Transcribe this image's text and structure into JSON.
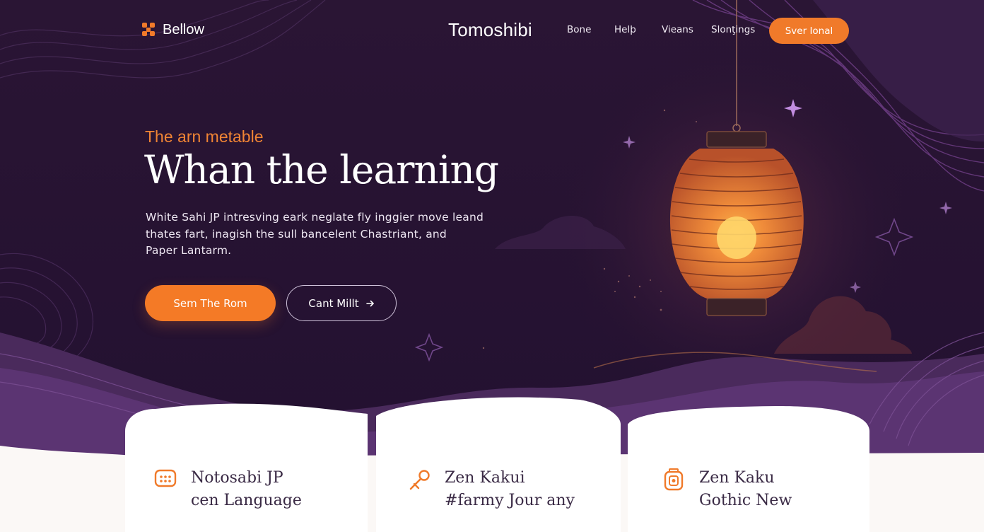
{
  "nav": {
    "logo_text": "Bellow",
    "brand": "Tomoshibi",
    "links": [
      "Bone",
      "Helþ",
      "Vieans",
      "Slonţings"
    ],
    "cta_label": "Sver Ional"
  },
  "hero": {
    "eyebrow": "The arn metable",
    "headline": "Whan the learning",
    "body_lines": [
      "White Sahi JP intresving eark neglate fly inggier move leand",
      "thates fart, inagish the sull bancelent Chastriant, and",
      "Paper Lantarm."
    ],
    "primary_button": "Sem The Rom",
    "secondary_button": "Cant Millt",
    "secondary_button_icon": "arrow-icon"
  },
  "cards": [
    {
      "icon": "chat-icon",
      "title_line1": "Notosabi JP",
      "title_line2": "cen Language"
    },
    {
      "icon": "tool-icon",
      "title_line1": "Zen Kakui",
      "title_line2": "#farmy Jour any"
    },
    {
      "icon": "lantern-icon",
      "title_line1": "Zen Kaku",
      "title_line2": "Gothic New"
    }
  ],
  "colors": {
    "background": "#24122f",
    "accent": "#f47a26",
    "card_bg": "#ffffff",
    "wave_purple": "#5a3470"
  }
}
